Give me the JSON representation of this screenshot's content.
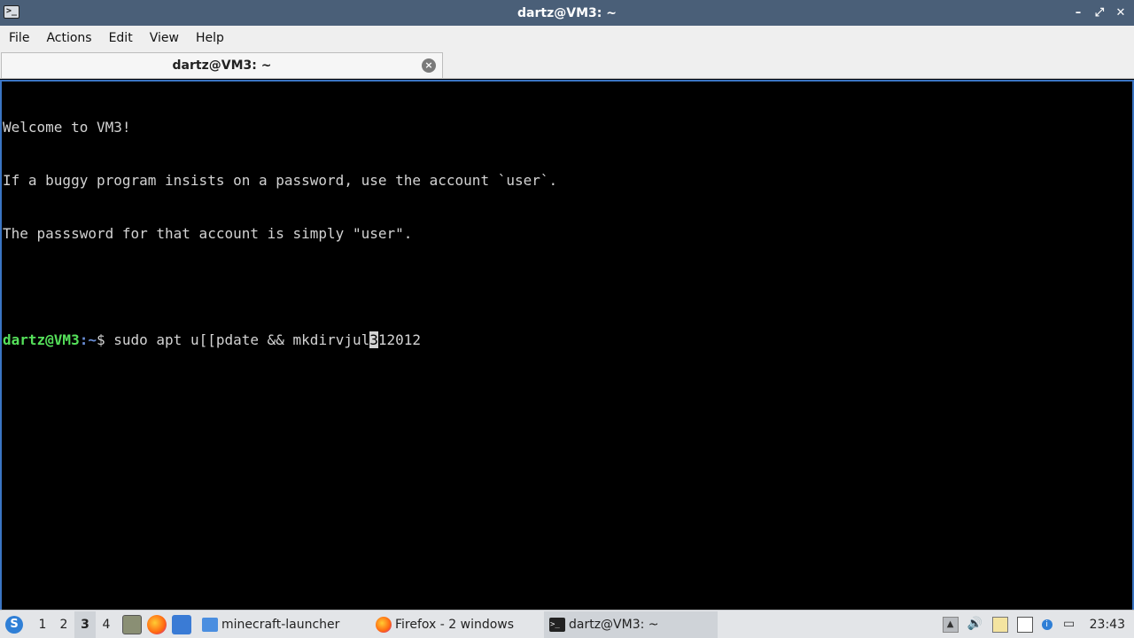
{
  "window": {
    "title": "dartz@VM3: ~",
    "app_icon": ">_",
    "controls": [
      "–",
      "✕ minimize-restore",
      "✕"
    ]
  },
  "menubar": {
    "items": [
      "File",
      "Actions",
      "Edit",
      "View",
      "Help"
    ]
  },
  "tab": {
    "label": "dartz@VM3: ~",
    "close_icon": "×"
  },
  "terminal": {
    "lines": [
      "Welcome to VM3!",
      "If a buggy program insists on a password, use the account `user`.",
      "The passsword for that account is simply \"user\"."
    ],
    "prompt_user": "dartz@VM3",
    "prompt_sep": ":",
    "prompt_path": "~",
    "prompt_symbol": "$ ",
    "command_before_cursor": "sudo apt u[[pdate && mkdirvjul",
    "cursor_char": "3",
    "command_after_cursor": "12012"
  },
  "taskbar": {
    "desktops": [
      "1",
      "2",
      "3",
      "4"
    ],
    "active_desktop": "3",
    "tasks": [
      {
        "label": "minecraft-launcher",
        "icon": "folder-icon"
      },
      {
        "label": "Firefox - 2 windows",
        "icon": "firefox-icon"
      },
      {
        "label": "dartz@VM3: ~",
        "icon": "terminal-icon"
      }
    ],
    "clock": "23:43"
  },
  "colors": {
    "titlebar": "#4a5f78",
    "prompt_user": "#55e05a",
    "prompt_path": "#6a8fd8",
    "terminal_border": "#3a75c4"
  }
}
